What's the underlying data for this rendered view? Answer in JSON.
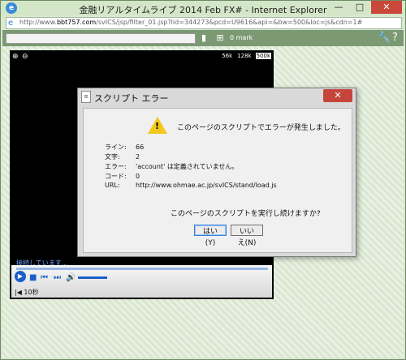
{
  "window": {
    "title": "金融リアルタイムライブ  2014 Feb FX# - Internet Explorer",
    "controls": {
      "minimize": "—",
      "maximize": "□",
      "close": "✕"
    }
  },
  "address": {
    "prefix": "http://www.",
    "domain": "bbt757.com",
    "rest": "/svICS/jsp/filter_01.jsp?lid=344273&pcd=U9616&api=&bw=500&loc=js&cdn=1#"
  },
  "toolbar": {
    "mark_label": "0 mark",
    "progress_fraction": 0.0
  },
  "player": {
    "rates": [
      "56k",
      "128k",
      "500k"
    ],
    "selected_rate": "500k",
    "status": "接続しています...",
    "timer": "10秒"
  },
  "dialog": {
    "title": "スクリプト エラー",
    "message": "このページのスクリプトでエラーが発生しました。",
    "details": [
      {
        "key": "ライン:",
        "value": "66"
      },
      {
        "key": "文字:",
        "value": "2"
      },
      {
        "key": "エラー:",
        "value": "'account' は定義されていません。"
      },
      {
        "key": "コード:",
        "value": "0"
      },
      {
        "key": "URL:",
        "value": "http://www.ohmae.ac.jp/svICS/stand/load.js"
      }
    ],
    "question": "このページのスクリプトを実行し続けますか?",
    "yes_label": "はい(Y)",
    "no_label": "いいえ(N)",
    "close_label": "✕"
  }
}
